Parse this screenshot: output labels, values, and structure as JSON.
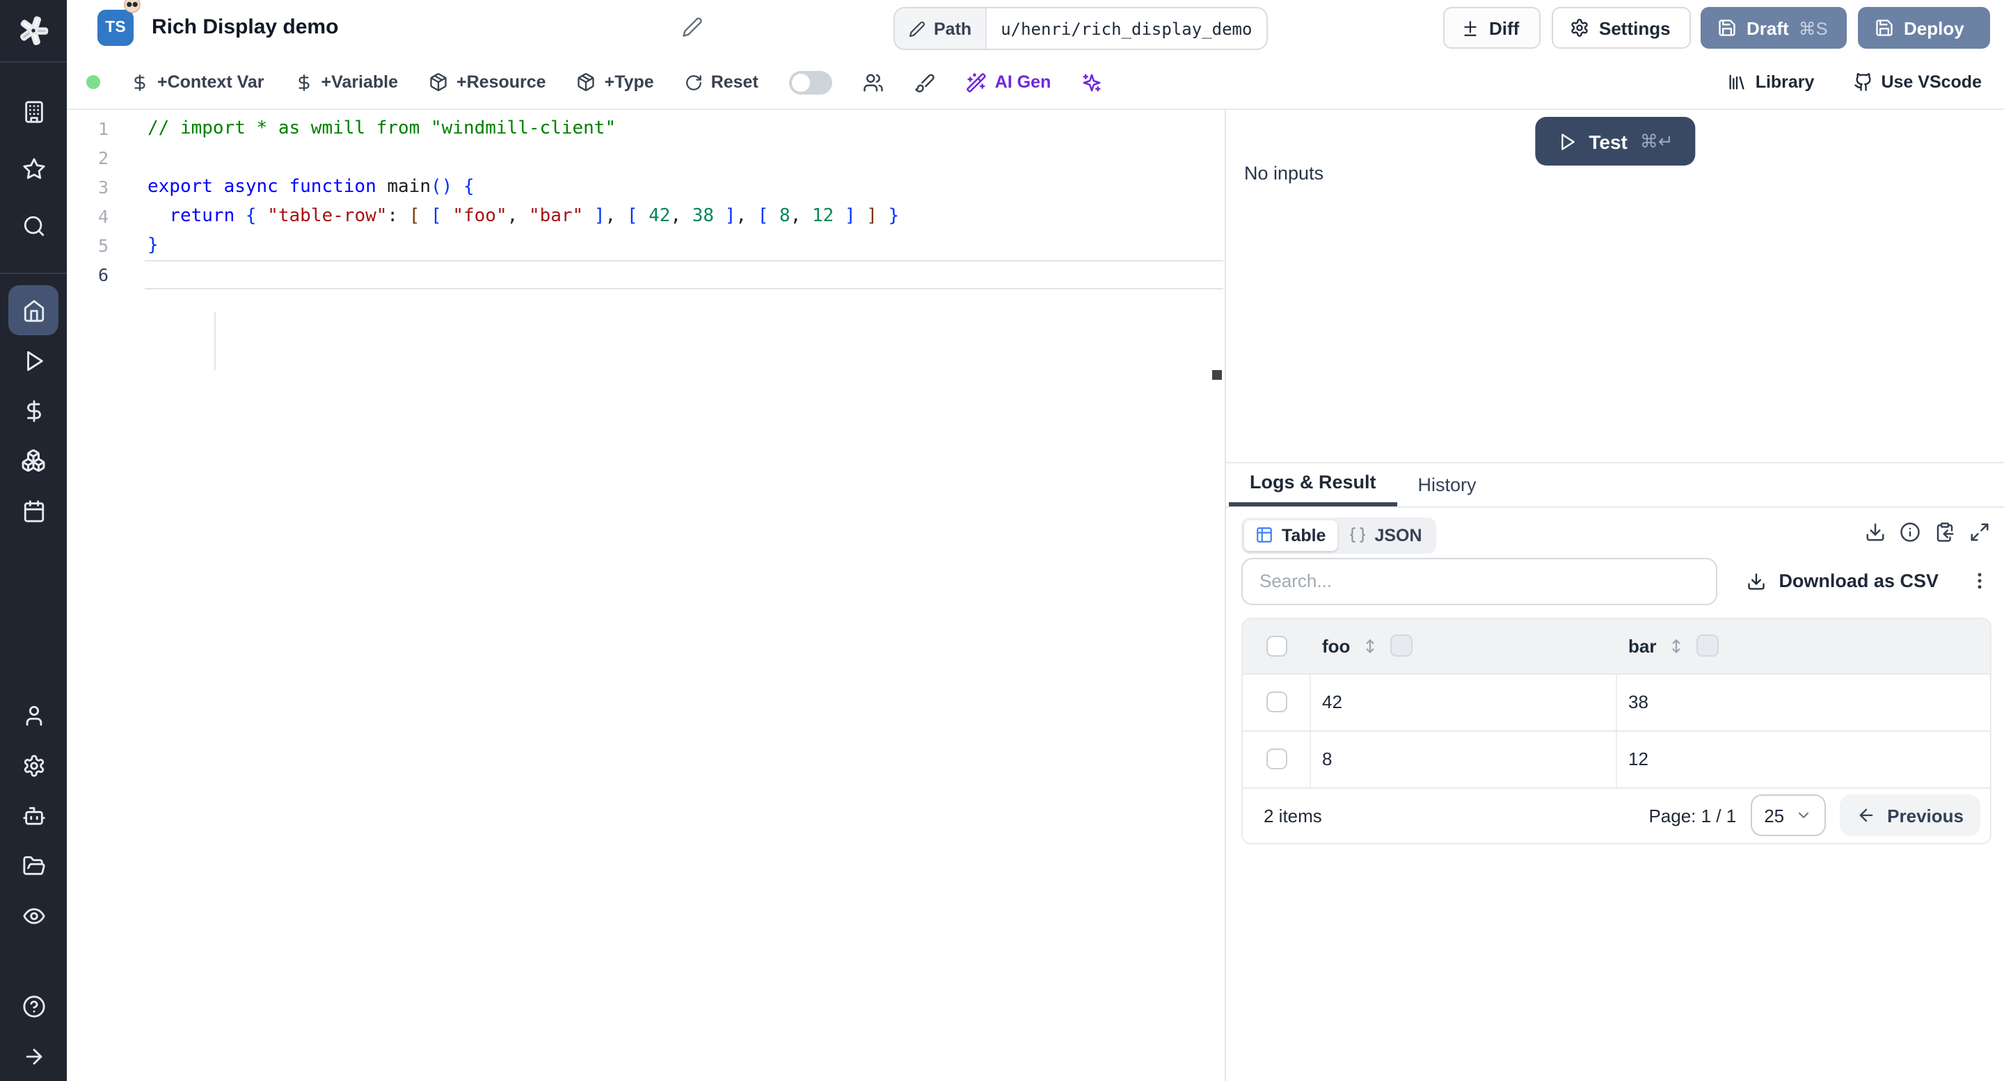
{
  "header": {
    "lang_badge": "TS",
    "title": "Rich Display demo",
    "path_label": "Path",
    "path_value": "u/henri/rich_display_demo",
    "diff_label": "Diff",
    "settings_label": "Settings",
    "draft_label": "Draft",
    "draft_shortcut": "⌘S",
    "deploy_label": "Deploy",
    "accent_button_color": "#6c82a5",
    "ts_badge_color": "#3178c6"
  },
  "toolbar": {
    "context_var": "+Context Var",
    "variable": "+Variable",
    "resource": "+Resource",
    "type": "+Type",
    "reset": "Reset",
    "ai_gen": "AI Gen",
    "library": "Library",
    "vscode": "Use VScode",
    "ai_accent_color": "#6d28d9",
    "status_dot_color": "#7ddf8d"
  },
  "sidebar": {
    "icons": [
      "windmill-logo",
      "workspace-building",
      "favorites-star",
      "search",
      "home",
      "runs-play",
      "variables-dollar",
      "resources-boxes",
      "schedules-calendar",
      "users-person",
      "settings-gear",
      "workers-robot",
      "folders",
      "audit-eye",
      "help-circle",
      "expand-arrow"
    ]
  },
  "editor": {
    "lines": [
      {
        "num": "1",
        "tokens": [
          [
            "c",
            "// import * as wmill from \"windmill-client\""
          ]
        ]
      },
      {
        "num": "2",
        "tokens": []
      },
      {
        "num": "3",
        "tokens": [
          [
            "k",
            "export async function "
          ],
          [
            "p",
            "main"
          ],
          [
            "b1",
            "()"
          ],
          [
            "p",
            " "
          ],
          [
            "b1",
            "{"
          ]
        ]
      },
      {
        "num": "4",
        "tokens": [
          [
            "p",
            "  "
          ],
          [
            "k",
            "return"
          ],
          [
            "p",
            " "
          ],
          [
            "b1",
            "{"
          ],
          [
            "p",
            " "
          ],
          [
            "s",
            "\"table-row\""
          ],
          [
            "p",
            ": "
          ],
          [
            "b2",
            "["
          ],
          [
            "p",
            " "
          ],
          [
            "b1",
            "["
          ],
          [
            "p",
            " "
          ],
          [
            "s",
            "\"foo\""
          ],
          [
            "p",
            ", "
          ],
          [
            "s",
            "\"bar\""
          ],
          [
            "p",
            " "
          ],
          [
            "b1",
            "]"
          ],
          [
            "p",
            ", "
          ],
          [
            "b1",
            "["
          ],
          [
            "p",
            " "
          ],
          [
            "n",
            "42"
          ],
          [
            "p",
            ", "
          ],
          [
            "n",
            "38"
          ],
          [
            "p",
            " "
          ],
          [
            "b1",
            "]"
          ],
          [
            "p",
            ", "
          ],
          [
            "b1",
            "["
          ],
          [
            "p",
            " "
          ],
          [
            "n",
            "8"
          ],
          [
            "p",
            ", "
          ],
          [
            "n",
            "12"
          ],
          [
            "p",
            " "
          ],
          [
            "b1",
            "]"
          ],
          [
            "p",
            " "
          ],
          [
            "b2",
            "]"
          ],
          [
            "p",
            " "
          ],
          [
            "b1",
            "}"
          ]
        ]
      },
      {
        "num": "5",
        "tokens": [
          [
            "b1",
            "}"
          ]
        ]
      },
      {
        "num": "6",
        "tokens": [],
        "current": true
      }
    ]
  },
  "run_panel": {
    "test_label": "Test",
    "test_shortcut": "⌘↵",
    "no_inputs": "No inputs",
    "test_button_color": "#3a4963"
  },
  "result_panel": {
    "tabs": [
      "Logs & Result",
      "History"
    ],
    "view_toggle": {
      "table": "Table",
      "json": "JSON"
    },
    "search_placeholder": "Search...",
    "download_csv": "Download as CSV",
    "table": {
      "columns": [
        "foo",
        "bar"
      ],
      "rows": [
        [
          "42",
          "38"
        ],
        [
          "8",
          "12"
        ]
      ],
      "items_label": "2 items",
      "page_label": "Page: 1 / 1",
      "page_size": "25",
      "previous_label": "Previous"
    }
  }
}
